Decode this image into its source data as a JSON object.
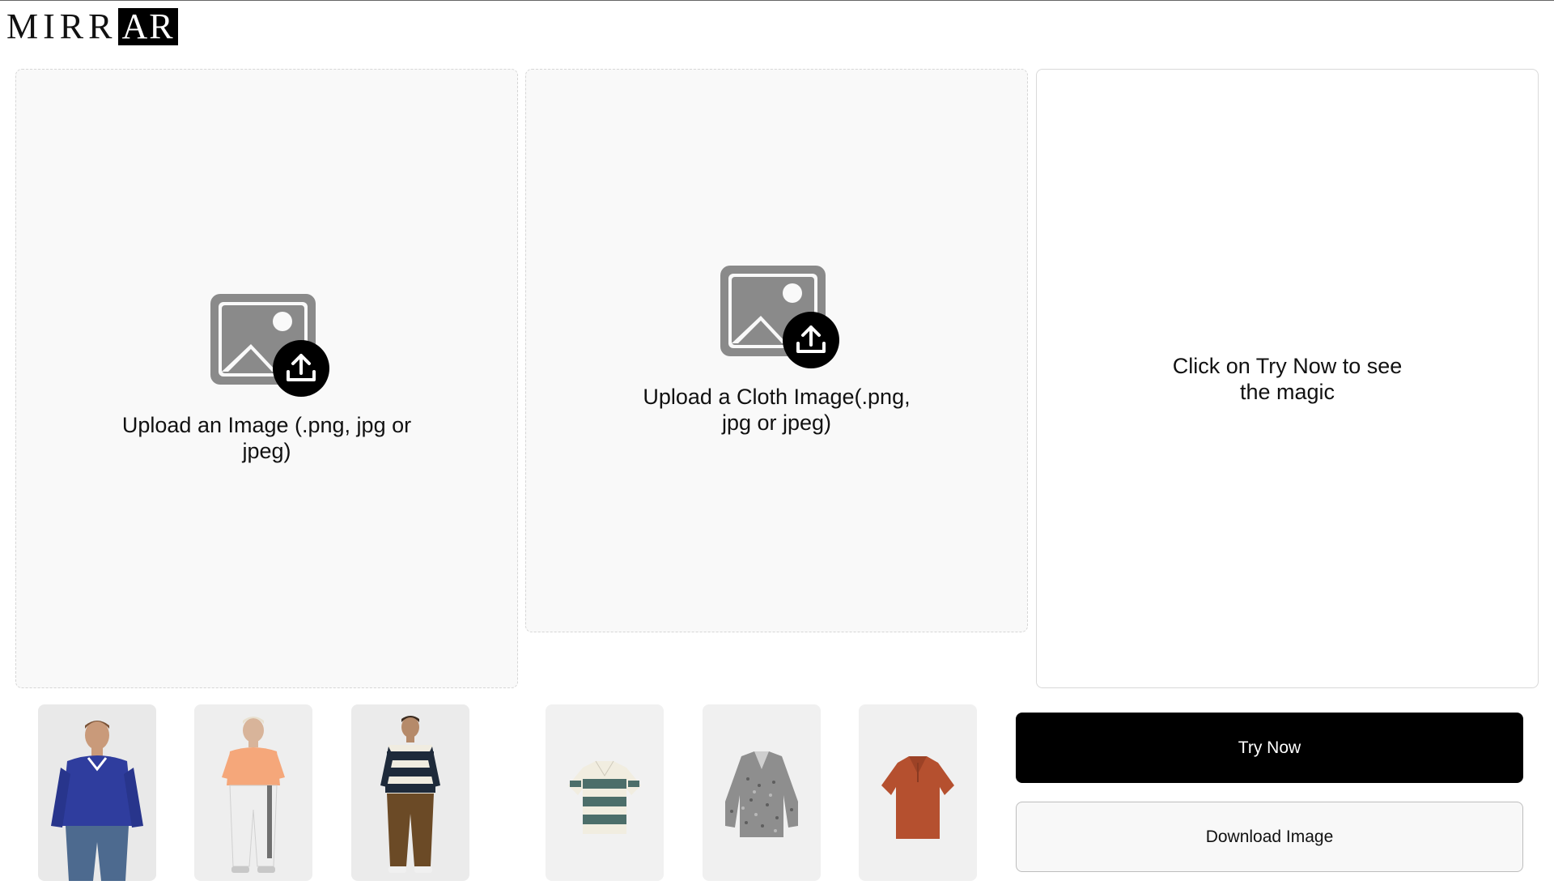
{
  "app": {
    "logo_left": "MIRR",
    "logo_right": "AR"
  },
  "panels": {
    "person_upload": {
      "label": "Upload an Image (.png, jpg or jpeg)",
      "icon": "image-upload-icon"
    },
    "cloth_upload": {
      "label": "Upload a Cloth Image(.png, jpg or jpeg)",
      "icon": "image-upload-icon"
    },
    "result": {
      "label": "Click on Try Now to see the magic"
    }
  },
  "samples": {
    "people": [
      {
        "name": "model-blue-sweater"
      },
      {
        "name": "model-peach-tshirt"
      },
      {
        "name": "model-striped-polo"
      }
    ],
    "clothes": [
      {
        "name": "green-striped-polo"
      },
      {
        "name": "grey-knit-sweater"
      },
      {
        "name": "rust-polo-shirt"
      }
    ]
  },
  "actions": {
    "try_now": "Try Now",
    "download": "Download Image"
  },
  "colors": {
    "primary": "#000000",
    "panel_bg": "#f9f9f9",
    "icon_grey": "#8a8a8a"
  }
}
